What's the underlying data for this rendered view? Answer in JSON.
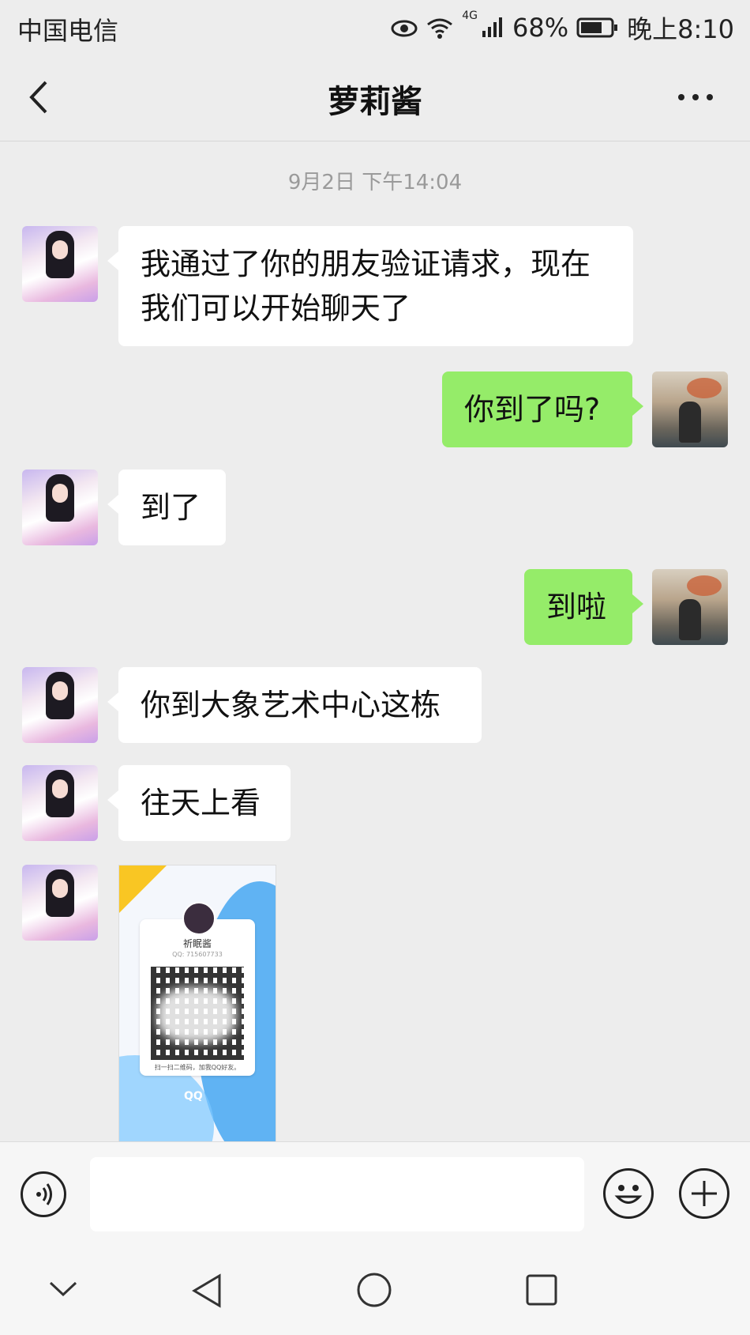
{
  "status_bar": {
    "carrier": "中国电信",
    "network": "4G",
    "battery": "68%",
    "time": "晚上8:10"
  },
  "header": {
    "title": "萝莉酱"
  },
  "chat": {
    "timestamp": "9月2日 下午14:04",
    "messages": [
      {
        "from": "contact",
        "text": "我通过了你的朋友验证请求，现在我们可以开始聊天了"
      },
      {
        "from": "me",
        "text": "你到了吗?"
      },
      {
        "from": "contact",
        "text": "到了"
      },
      {
        "from": "me",
        "text": "到啦"
      },
      {
        "from": "contact",
        "text": "你到大象艺术中心这栋"
      },
      {
        "from": "contact",
        "text": "往天上看"
      }
    ],
    "image_message": {
      "card_name": "祈眠酱",
      "card_qq": "QQ: 715607733",
      "card_caption": "扫一扫二维码，加我QQ好友。",
      "brand": "QQ"
    }
  },
  "input_bar": {
    "voice_icon": "voice-icon",
    "emoji_icon": "emoji-icon",
    "plus_icon": "plus-icon"
  },
  "system_nav": {
    "icons": [
      "chevron-down-icon",
      "back-triangle-icon",
      "home-circle-icon",
      "recents-square-icon"
    ]
  }
}
